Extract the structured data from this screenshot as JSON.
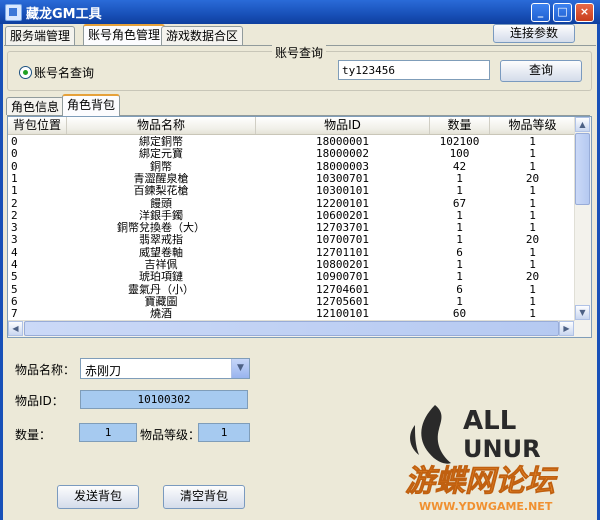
{
  "window": {
    "title": "藏龙GM工具",
    "minimize_label": "_",
    "maximize_label": "□",
    "close_label": "×"
  },
  "top_tabs": [
    {
      "label": "服务端管理"
    },
    {
      "label": "账号角色管理"
    },
    {
      "label": "游戏数据合区"
    }
  ],
  "connect_button": "连接参数",
  "account_query": {
    "group_title": "账号查询",
    "radio_label": "账号名查询",
    "input_value": "ty123456",
    "query_button": "查询"
  },
  "sub_tabs": [
    {
      "label": "角色信息"
    },
    {
      "label": "角色背包"
    }
  ],
  "table": {
    "columns": [
      "背包位置",
      "物品名称",
      "物品ID",
      "数量",
      "物品等级"
    ],
    "rows": [
      [
        "0",
        "綁定銅幣",
        "18000001",
        "102100",
        "1"
      ],
      [
        "0",
        "綁定元寶",
        "18000002",
        "100",
        "1"
      ],
      [
        "0",
        "銅幣",
        "18000003",
        "42",
        "1"
      ],
      [
        "1",
        "青澀醒泉槍",
        "10300701",
        "1",
        "20"
      ],
      [
        "1",
        "百鍊梨花槍",
        "10300101",
        "1",
        "1"
      ],
      [
        "2",
        "饅頭",
        "12200101",
        "67",
        "1"
      ],
      [
        "2",
        "洋銀手鐲",
        "10600201",
        "1",
        "1"
      ],
      [
        "3",
        "銅幣兌換卷（大）",
        "12703701",
        "1",
        "1"
      ],
      [
        "3",
        "翡翠戒指",
        "10700701",
        "1",
        "20"
      ],
      [
        "4",
        "威望卷軸",
        "12701101",
        "6",
        "1"
      ],
      [
        "4",
        "吉祥佩",
        "10800201",
        "1",
        "1"
      ],
      [
        "5",
        "琥珀項鏈",
        "10900701",
        "1",
        "20"
      ],
      [
        "5",
        "靈氣丹（小）",
        "12704601",
        "6",
        "1"
      ],
      [
        "6",
        "寶藏圖",
        "12705601",
        "1",
        "1"
      ],
      [
        "7",
        "燒酒",
        "12100101",
        "60",
        "1"
      ]
    ]
  },
  "form": {
    "item_name_label": "物品名称：",
    "item_name_value": "赤刚刀",
    "item_id_label": "物品ID：",
    "item_id_value": "10100302",
    "quantity_label": "数量：",
    "quantity_value": "1",
    "item_level_label": "物品等级：",
    "item_level_value": "1",
    "send_button": "发送背包",
    "clear_button": "清空背包"
  },
  "watermark": {
    "logo_text_top": "ALL",
    "logo_text_bottom": "UNUR",
    "site_name": "游蝶网论坛",
    "site_url": "WWW.YDWGAME.NET"
  },
  "colors": {
    "accent": "#1850b8",
    "field_blue": "#a6caf0",
    "brand_orange": "#f09030",
    "radio_green": "#21a121"
  }
}
